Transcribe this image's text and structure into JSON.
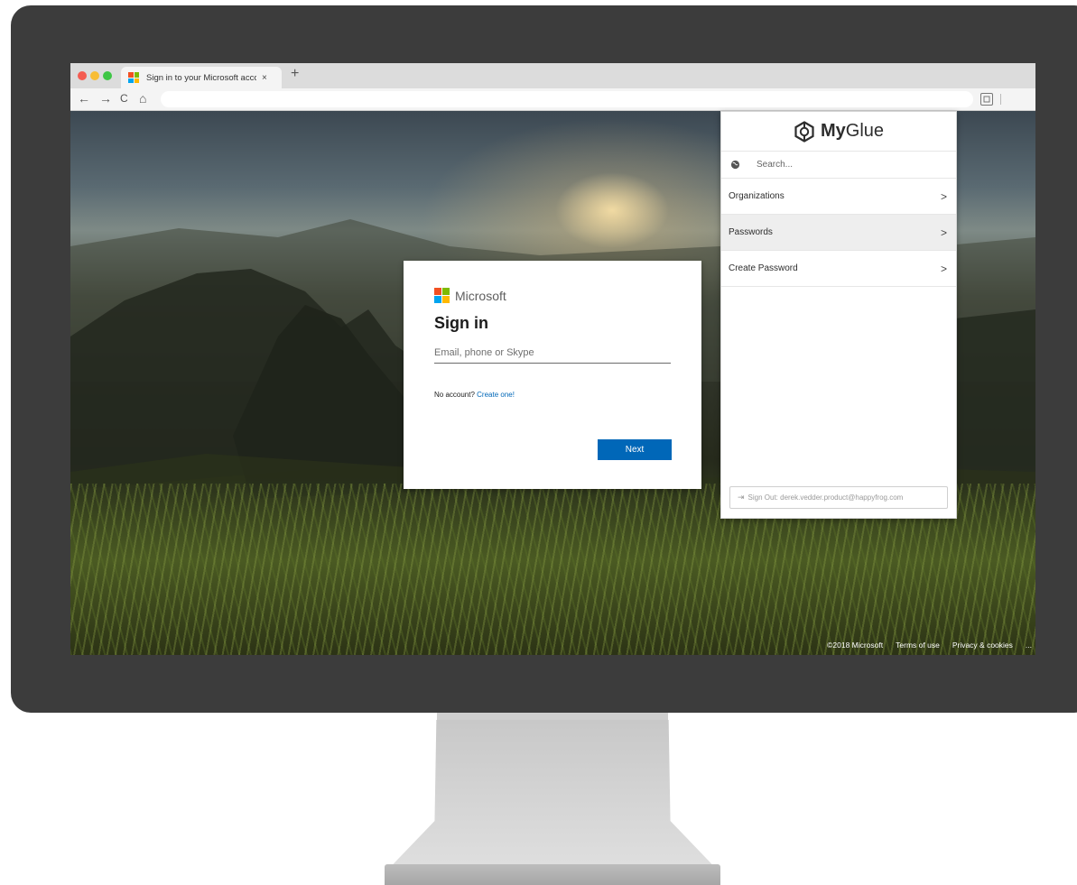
{
  "browser": {
    "tab_title": "Sign in to your Microsoft acco",
    "tab_close": "×",
    "new_tab": "+",
    "nav": {
      "back": "←",
      "forward": "→",
      "reload": "C",
      "home": "⌂"
    }
  },
  "signin": {
    "brand": "Microsoft",
    "title": "Sign in",
    "email_placeholder": "Email, phone or Skype",
    "no_account_text": "No account?",
    "create_link": "Create one!",
    "next_label": "Next"
  },
  "footer": {
    "copyright": "©2018 Microsoft",
    "terms": "Terms of use",
    "privacy": "Privacy & cookies",
    "more": "..."
  },
  "myglue": {
    "brand_bold": "My",
    "brand_rest": "Glue",
    "search_placeholder": "Search...",
    "menu": [
      {
        "label": "Organizations",
        "chevron": ">"
      },
      {
        "label": "Passwords",
        "chevron": ">"
      },
      {
        "label": "Create Password",
        "chevron": ">"
      }
    ],
    "active_item": "Passwords",
    "signout_label": "Sign Out: derek.vedder.product@happyfrog.com",
    "signout_icon": "⇥"
  },
  "colors": {
    "ms_blue": "#0067b8",
    "ms_logo": [
      "#f25022",
      "#7fba00",
      "#00a4ef",
      "#ffb900"
    ],
    "traffic_lights": [
      "#f45c51",
      "#f8bd35",
      "#3ec645"
    ]
  }
}
